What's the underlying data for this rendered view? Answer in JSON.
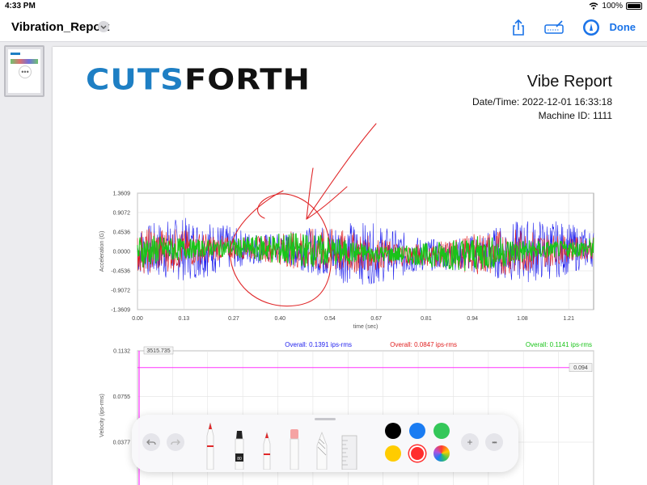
{
  "status_bar": {
    "time": "4:33 PM",
    "battery": "100%"
  },
  "nav": {
    "title": "Vibration_Report",
    "done_label": "Done"
  },
  "sidebar": {
    "thumb_more": "•••"
  },
  "report": {
    "logo_cuts": "CUTS",
    "logo_forth": "FORTH",
    "title": "Vibe Report",
    "datetime": "Date/Time: 2022-12-01 16:33:18",
    "machine_id": "Machine ID: 1111"
  },
  "chart_data": [
    {
      "type": "line",
      "ylabel": "Acceleration (G)",
      "xlabel": "time (sec)",
      "y_ticks": [
        "1.3609",
        "0.9072",
        "0.4536",
        "0.0000",
        "-0.4536",
        "-0.9072",
        "-1.3609"
      ],
      "x_ticks": [
        "0.00",
        "0.13",
        "0.27",
        "0.40",
        "0.54",
        "0.67",
        "0.81",
        "0.94",
        "1.08",
        "1.21"
      ],
      "ylim": [
        -1.3609,
        1.3609
      ],
      "xlim": [
        0,
        1.28
      ],
      "series": [
        {
          "color": "#2222ee",
          "amplitude": 0.55
        },
        {
          "color": "#e02020",
          "amplitude": 0.4
        },
        {
          "color": "#19c419",
          "amplitude": 0.3
        }
      ],
      "overall_labels": [
        {
          "text": "Overall: 0.1391 ips-rms",
          "color": "#2222ee"
        },
        {
          "text": "Overall: 0.0847 ips-rms",
          "color": "#e02020"
        },
        {
          "text": "Overall: 0.1141 ips-rms",
          "color": "#19c419"
        }
      ],
      "grid": true
    },
    {
      "type": "line",
      "ylabel": "Velocity (ips-rms)",
      "y_ticks": [
        "0.1132",
        "0.0755",
        "0.0377"
      ],
      "marker_left": "3515.735",
      "marker_right": "0.094",
      "series": [
        {
          "color": "#ff33ff",
          "value": 0.094
        }
      ],
      "grid": true
    }
  ],
  "toolbar": {
    "more_label": "•••",
    "add_label": "+",
    "colors": [
      "#000000",
      "#1a7cf2",
      "#34c759",
      "#ffcc00",
      "#ff2d2d",
      "rainbow"
    ],
    "selected_color": "#ff2d2d",
    "marker_label": "80"
  }
}
